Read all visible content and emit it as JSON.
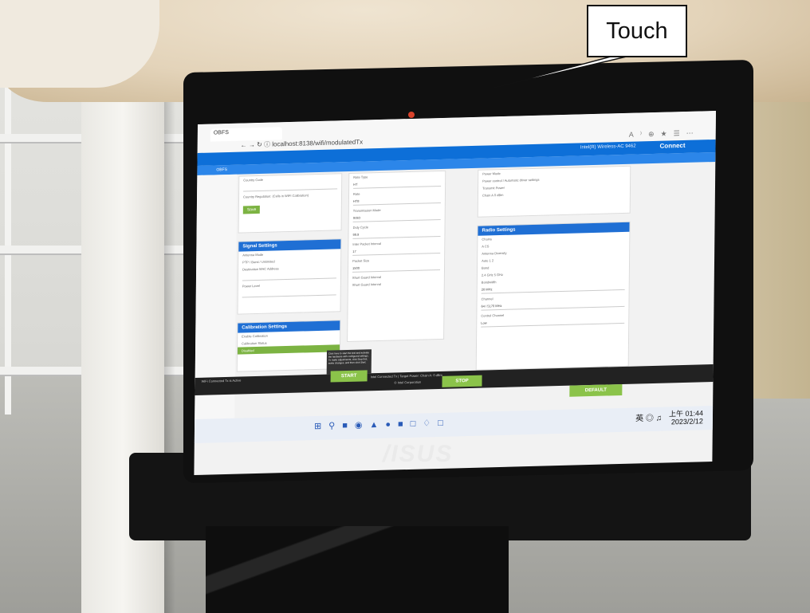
{
  "callout": {
    "label": "Touch"
  },
  "brand": {
    "logo": "/ISUS"
  },
  "browser": {
    "tab_title": "OBFS",
    "url": "localhost:8138/wifi/modulatedTx"
  },
  "app": {
    "adapter": "Intel(R) Wireless-AC 9462",
    "connect_label": "Connect",
    "nav_title": "OBFS"
  },
  "left": {
    "country_label": "Country Code",
    "country_note": "Country Regulation: (Cells in WIFI Calibration)",
    "save": "Save",
    "signal_title": "Signal Settings",
    "antenna_label": "Antenna Mode",
    "antenna_opts": [
      "PTP",
      "Burst",
      "Unlimited"
    ],
    "dest_label": "Destination MAC Address",
    "power_label": "Power Level",
    "calib_title": "Calibration Settings",
    "calib_toggle": "Enable Calibration",
    "calib_state_label": "Calibration Status",
    "calib_state": "Disabled"
  },
  "mid": {
    "rate_type": "Rate Type",
    "rate_type_val": "HT",
    "rate": "Rate",
    "rate_val": "HT8",
    "tx_mode": "Transmission Mode",
    "tx_mode_val": "SISO",
    "duty": "Duty Cycle",
    "duty_val": "99.9",
    "inter": "Inter Packet Interval",
    "inter_val": "17",
    "size": "Packet Size",
    "size_val": "1500",
    "guard": "Short Guard Interval",
    "guard_chk": "Short Guard Interval",
    "tooltip": "Click here to start the test and activate the hardware with configured settings. To make adjustments, click Stop first, make changes, and then click Start.",
    "start": "START"
  },
  "right": {
    "power_mode": "Power Mode",
    "power_opts": [
      "Power control",
      "Automatic driver settings"
    ],
    "tx_power": "Transmit Power",
    "tx_power_val": "0",
    "tx_power_unit": "dBm",
    "chain_label": "Chain A",
    "radio_title": "Radio Settings",
    "chains": "Chains",
    "chain_opt": "A CS",
    "div": "Antenna Diversity",
    "div_opts": [
      "Auto",
      "1",
      "2"
    ],
    "band": "Band",
    "band_opts": [
      "2.4 GHz",
      "5 GHz"
    ],
    "bw": "Bandwidth",
    "bw_val": "20 MHz",
    "ch": "Channel",
    "ch_val": "64 / 5170 MHz",
    "cc": "Control Channel",
    "cc_val": "Low",
    "stop": "STOP",
    "defaults": "DEFAULT"
  },
  "status": {
    "line1": "Intel Connected Tx | Target Power: Chain A: 0 dBm",
    "line2": "© Intel Corporation",
    "left_note": "WiFi Connected Tx is Active"
  },
  "taskbar": {
    "lang": "英",
    "time": "上午 01:44",
    "date": "2023/2/12"
  }
}
